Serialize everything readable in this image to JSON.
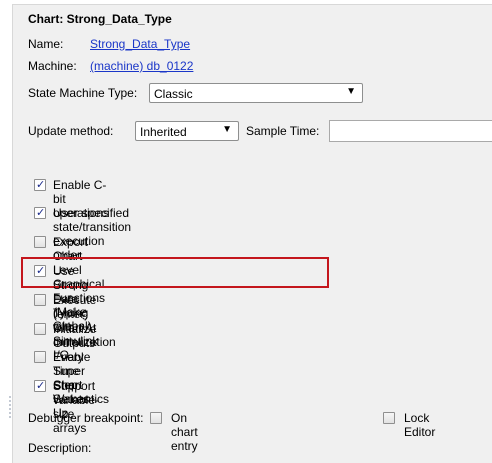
{
  "chart": {
    "title": "Chart: Strong_Data_Type",
    "name_label": "Name:",
    "name_value": "Strong_Data_Type",
    "machine_label": "Machine:",
    "machine_value": "(machine) db_0122"
  },
  "state_machine": {
    "label": "State Machine Type:",
    "value": "Classic"
  },
  "update": {
    "label": "Update method:",
    "value": "Inherited",
    "sample_time_label": "Sample Time:",
    "sample_time_value": ""
  },
  "options": [
    {
      "label": "Enable C-bit operations",
      "checked": true
    },
    {
      "label": "User specified state/transition execution order",
      "checked": true
    },
    {
      "label": "Export Chart Level Graphical Functions (Make Global)",
      "checked": false
    },
    {
      "label": "Use Strong Data Typing with Simulink I/O",
      "checked": true
    },
    {
      "label": "Execute (enter) Chart At Initialization",
      "checked": false
    },
    {
      "label": "Initialize Outputs Every Time Chart Wakes Up",
      "checked": false
    },
    {
      "label": "Enable Super Step Semantics",
      "checked": false
    },
    {
      "label": "Support variable-size arrays",
      "checked": true
    }
  ],
  "debugger": {
    "label": "Debugger breakpoint:",
    "on_chart_entry_label": "On chart entry",
    "on_chart_entry_checked": false,
    "lock_editor_label": "Lock Editor",
    "lock_editor_checked": false
  },
  "description": {
    "label": "Description:"
  },
  "colors": {
    "panel_bg": "#f0f0f0",
    "link": "#1a36c8",
    "highlight": "#c4161c"
  }
}
